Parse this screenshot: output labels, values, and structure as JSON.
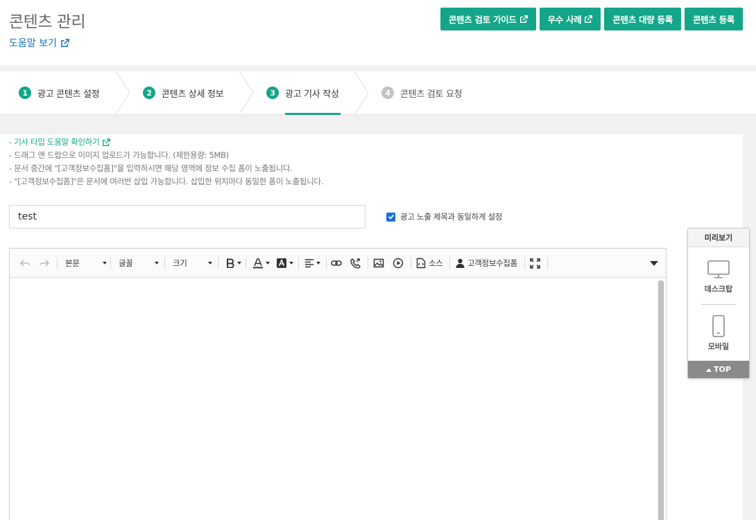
{
  "header": {
    "title": "콘텐츠 관리",
    "help_link": "도움말 보기",
    "buttons": {
      "review_guide": "콘텐츠 검토 가이드",
      "best_cases": "우수 사례",
      "bulk_register": "콘텐츠 대량 등록",
      "register": "콘텐츠 등록"
    }
  },
  "steps": [
    {
      "num": "1",
      "label": "광고 콘텐츠 설정"
    },
    {
      "num": "2",
      "label": "콘텐츠 상세 정보"
    },
    {
      "num": "3",
      "label": "광고 기사 작성"
    },
    {
      "num": "4",
      "label": "콘텐츠 검토 요청"
    }
  ],
  "notes": {
    "guide_link": "- 기사 타입 도움말 확인하기",
    "line1": "- 드래그 앤 드랍으로 이미지 업로드가 가능합니다. (제한용량: 5MB)",
    "line2": "- 문서 중간에 \"[고객정보수집폼]\"을 입력하시면 해당 영역에 정보 수집 폼이 노출됩니다.",
    "line3": "- \"[고객정보수집폼]\"은 문서에 여러번 삽입 가능합니다. 삽입한 위치마다 동일한 폼이 노출됩니다."
  },
  "form": {
    "title_value": "test",
    "same_title_label": "광고 노출 제목과 동일하게 설정",
    "same_title_checked": true
  },
  "toolbar": {
    "paragraph": "본문",
    "font": "글꼴",
    "size": "크기",
    "source": "소스",
    "customer_form": "고객정보수집폼"
  },
  "preview": {
    "title": "미리보기",
    "desktop": "데스크탑",
    "mobile": "모바일",
    "top": "TOP"
  },
  "colors": {
    "accent": "#13a689",
    "link": "#1a6fb5",
    "checkbox": "#1a6fe0"
  }
}
